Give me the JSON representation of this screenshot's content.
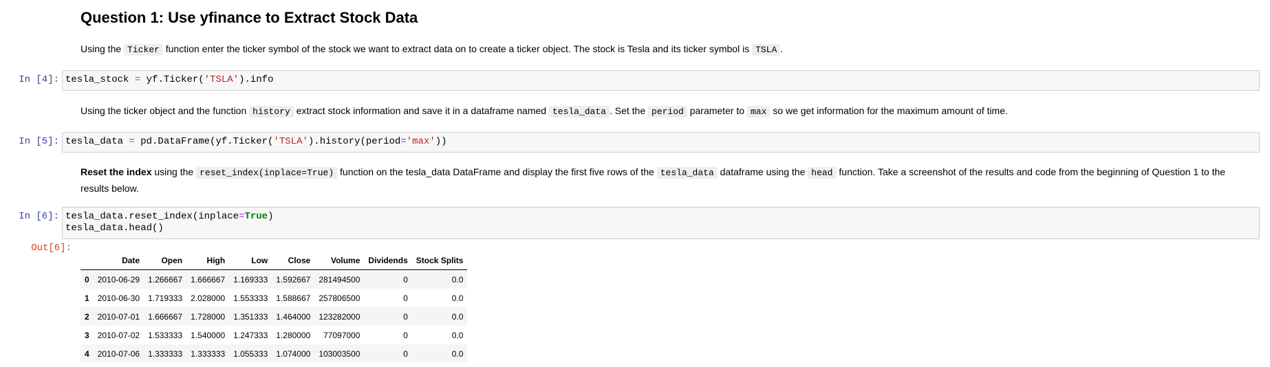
{
  "heading": "Question 1: Use yfinance to Extract Stock Data",
  "md1": {
    "p1": "Using the ",
    "c1": "Ticker",
    "p2": " function enter the ticker symbol of the stock we want to extract data on to create a ticker object. The stock is Tesla and its ticker symbol is ",
    "c2": "TSLA",
    "p3": "."
  },
  "cell4": {
    "prompt": "In [4]:",
    "a": "tesla_stock ",
    "op": "=",
    "b": " yf.Ticker(",
    "s": "'TSLA'",
    "c": ").info"
  },
  "md2": {
    "p1": "Using the ticker object and the function ",
    "c1": "history",
    "p2": " extract stock information and save it in a dataframe named ",
    "c2": "tesla_data",
    "p3": ". Set the ",
    "c3": "period",
    "p4": " parameter to ",
    "c4": "max",
    "p5": " so we get information for the maximum amount of time."
  },
  "cell5": {
    "prompt": "In [5]:",
    "a": "tesla_data ",
    "op": "=",
    "b": " pd.DataFrame(yf.Ticker(",
    "s": "'TSLA'",
    "c": ").history(period",
    "op2": "=",
    "s2": "'max'",
    "d": "))"
  },
  "md3": {
    "bold": "Reset the index",
    "p1": " using the ",
    "c1": "reset_index(inplace=True)",
    "p2": " function on the tesla_data DataFrame and display the first five rows of the ",
    "c2": "tesla_data",
    "p3": " dataframe using the ",
    "c3": "head",
    "p4": " function. Take a screenshot of the results and code from the beginning of Question 1 to the",
    "line2": "results below."
  },
  "cell6": {
    "prompt": "In [6]:",
    "l1a": "tesla_data.reset_index(inplace",
    "l1op": "=",
    "l1kw": "True",
    "l1b": ")",
    "l2": "tesla_data.head()"
  },
  "out6": {
    "prompt": "Out[6]:"
  },
  "table": {
    "columns": [
      "Date",
      "Open",
      "High",
      "Low",
      "Close",
      "Volume",
      "Dividends",
      "Stock Splits"
    ],
    "rows": [
      {
        "index": "0",
        "cells": [
          "2010-06-29",
          "1.266667",
          "1.666667",
          "1.169333",
          "1.592667",
          "281494500",
          "0",
          "0.0"
        ]
      },
      {
        "index": "1",
        "cells": [
          "2010-06-30",
          "1.719333",
          "2.028000",
          "1.553333",
          "1.588667",
          "257806500",
          "0",
          "0.0"
        ]
      },
      {
        "index": "2",
        "cells": [
          "2010-07-01",
          "1.666667",
          "1.728000",
          "1.351333",
          "1.464000",
          "123282000",
          "0",
          "0.0"
        ]
      },
      {
        "index": "3",
        "cells": [
          "2010-07-02",
          "1.533333",
          "1.540000",
          "1.247333",
          "1.280000",
          "77097000",
          "0",
          "0.0"
        ]
      },
      {
        "index": "4",
        "cells": [
          "2010-07-06",
          "1.333333",
          "1.333333",
          "1.055333",
          "1.074000",
          "103003500",
          "0",
          "0.0"
        ]
      }
    ]
  }
}
